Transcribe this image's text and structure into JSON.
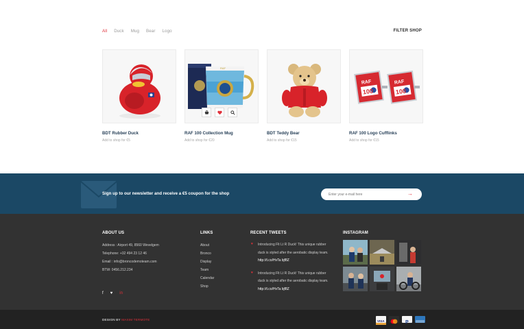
{
  "filters": [
    "All",
    "Duck",
    "Mug",
    "Bear",
    "Logo"
  ],
  "filter_shop_label": "FILTER SHOP",
  "products": [
    {
      "name": "BDT Rubber Duck",
      "price": "Add to shop for €5"
    },
    {
      "name": "RAF 100 Collection Mug",
      "price": "Add to shop for €20"
    },
    {
      "name": "BDT Teddy Bear",
      "price": "Add to shop for €15"
    },
    {
      "name": "RAF 100 Logo Cufflinks",
      "price": "Add to shop for €15"
    }
  ],
  "newsletter": {
    "text": "Sign up to our newsletter and receive a €5 coupon for the shop",
    "placeholder": "Enter your e-mail here",
    "submit_icon": "arrow-right-icon"
  },
  "about": {
    "heading": "ABOUT US",
    "lines": [
      "Address : Airport 49, 8560 Wevelgem",
      "Telephone: +32 494 23 12 46",
      "Email : info@broncodemoteam.com",
      "BTW: 0456.212.234"
    ],
    "socials": [
      "facebook-icon",
      "twitter-icon",
      "linkedin-icon"
    ]
  },
  "links": {
    "heading": "LINKS",
    "items": [
      "About",
      "Bronco",
      "Display",
      "Team",
      "Calendar",
      "Shop"
    ]
  },
  "tweets": {
    "heading": "RECENT TWEETS",
    "items": [
      {
        "text": "Introducing Flt Lt R Duck! This unique rubber duck is styled after the aerobatic display team.",
        "link": "http://t.co/HvTa bjf8Z"
      },
      {
        "text": "Introducing Flt Lt R Duck! This unique rubber duck is styled after the aerobatic display team.",
        "link": "http://t.co/HvTa bjf8Z"
      }
    ]
  },
  "instagram": {
    "heading": "INSTAGRAM"
  },
  "footer_bottom": {
    "design_by": "DESIGN BY",
    "designer": "MAXIM TERMOTE",
    "payment_icons": [
      "visa-icon",
      "mastercard-icon",
      "paypal-icon",
      "amex-icon"
    ]
  },
  "colors": {
    "accent": "#e0303a",
    "newsletter_bg": "#1b4865",
    "footer_bg": "#323232",
    "bottombar_bg": "#222222"
  }
}
